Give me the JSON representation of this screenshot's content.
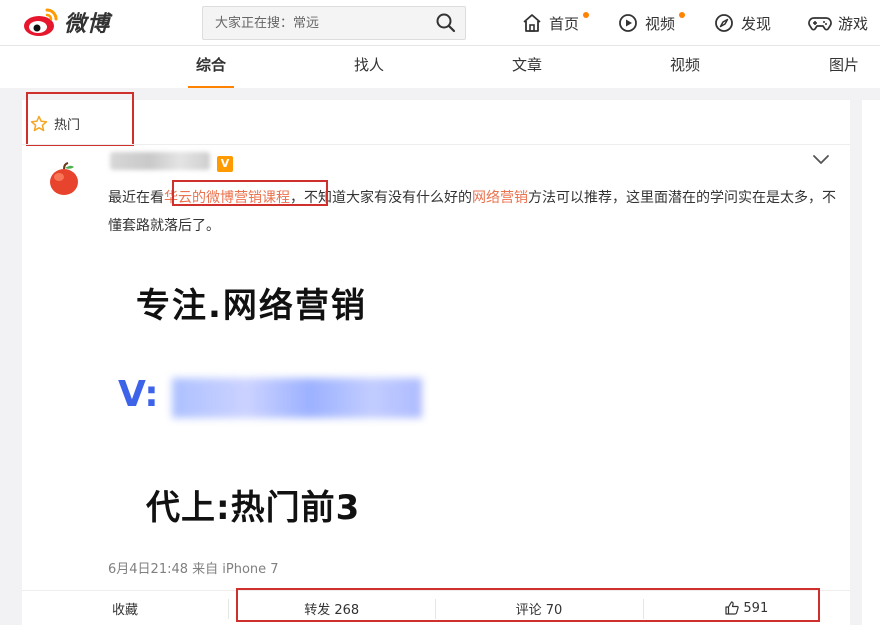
{
  "header": {
    "logo_text": "微博",
    "search_placeholder": "大家正在搜：常远",
    "nav": [
      {
        "label": "首页",
        "icon": "home-icon"
      },
      {
        "label": "视频",
        "icon": "video-icon"
      },
      {
        "label": "发现",
        "icon": "compass-icon"
      },
      {
        "label": "游戏",
        "icon": "gamepad-icon"
      }
    ]
  },
  "tabs": [
    "综合",
    "找人",
    "文章",
    "视频",
    "图片"
  ],
  "active_tab": "综合",
  "section": {
    "label": "热门",
    "icon": "star-icon"
  },
  "post": {
    "verified_badge": "V",
    "text_part1": "最近在看",
    "text_link1": "华云的微博营销课程",
    "text_part2": "，不知道大家有没有什么好的",
    "text_link2": "网络营销",
    "text_part3": "方法可以推荐，这里面潜在的学问实在是太多，不懂套路就落后了。",
    "image_line1": "专注.网络营销",
    "image_line2_prefix": "V:",
    "image_line3": "代上:热门前3",
    "meta": "6月4日21:48 来自 iPhone 7",
    "actions": {
      "favorite": "收藏",
      "repost": "转发 268",
      "comment": "评论 70",
      "like": "591"
    }
  },
  "colors": {
    "accent": "#ff8200",
    "link": "#eb7350",
    "highlight": "#d0302c"
  }
}
